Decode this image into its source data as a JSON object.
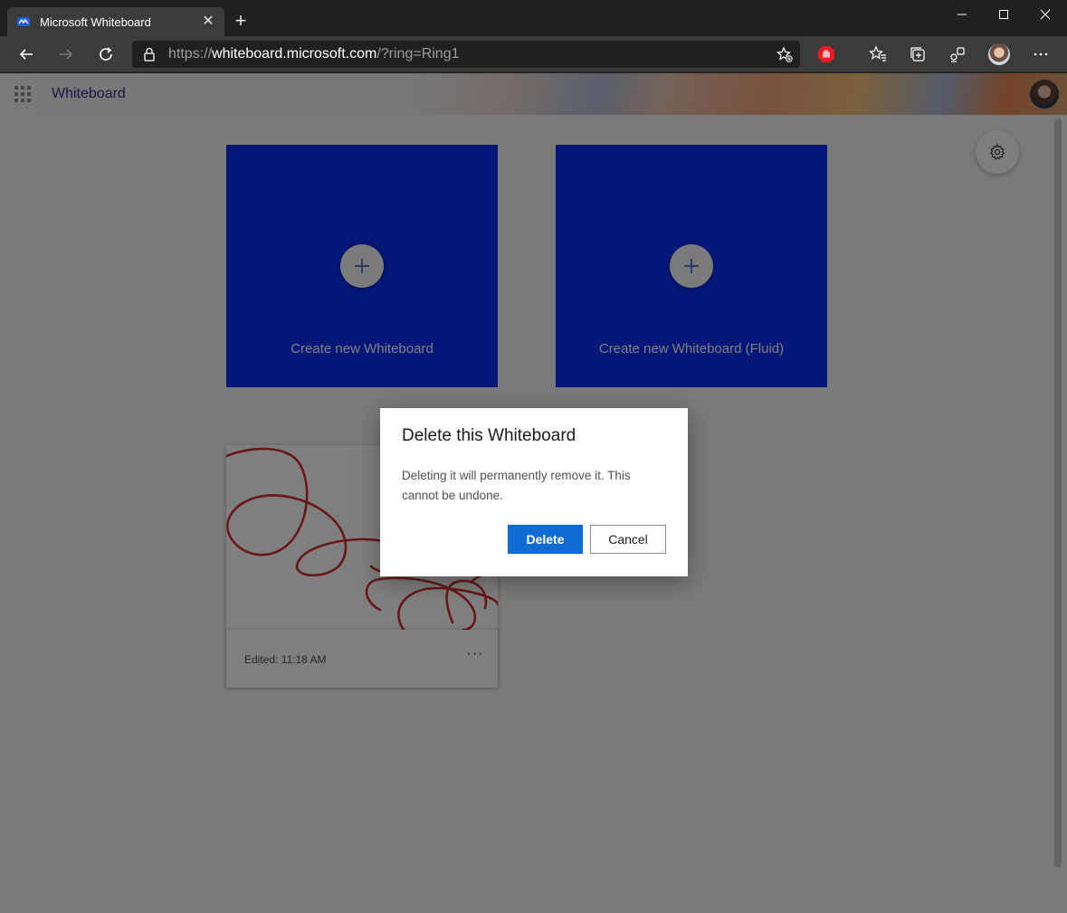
{
  "browser": {
    "tab_title": "Microsoft Whiteboard",
    "url_scheme": "https://",
    "url_host": "whiteboard.microsoft.com",
    "url_path": "/?ring=Ring1"
  },
  "app": {
    "title": "Whiteboard"
  },
  "create_cards": [
    {
      "label": "Create new Whiteboard"
    },
    {
      "label": "Create new Whiteboard (Fluid)"
    }
  ],
  "board": {
    "edited": "Edited: 11:18 AM",
    "ink_color": "#d32f2f"
  },
  "dialog": {
    "title": "Delete this Whiteboard",
    "body": "Deleting it will permanently remove it. This cannot be undone.",
    "delete_label": "Delete",
    "cancel_label": "Cancel"
  },
  "colors": {
    "accent": "#0f6cd4",
    "create_card": "#0a2ff0",
    "app_title": "#2b2f8f"
  },
  "icons": {
    "tab_favicon": "whiteboard-icon",
    "settings": "gear-icon",
    "create": "plus-icon",
    "more": "more-icon"
  }
}
